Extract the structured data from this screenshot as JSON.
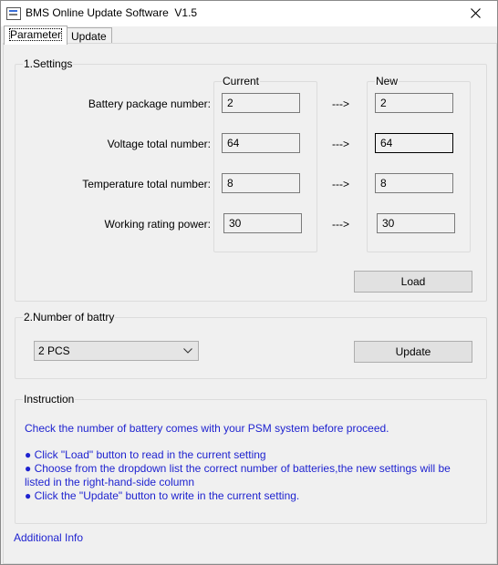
{
  "window": {
    "title": "BMS Online Update Software  V1.5"
  },
  "tabs": [
    {
      "label": "Parameter",
      "active": true
    },
    {
      "label": "Update",
      "active": false
    }
  ],
  "settings": {
    "group_title": "1.Settings",
    "current_header": "Current",
    "new_header": "New",
    "arrow": "--->",
    "rows": [
      {
        "label": "Battery package number:",
        "current": "2",
        "new": "2"
      },
      {
        "label": "Voltage total number:",
        "current": "64",
        "new": "64"
      },
      {
        "label": "Temperature total number:",
        "current": "8",
        "new": "8"
      },
      {
        "label": "Working rating power:",
        "current": "30",
        "new": "30"
      }
    ],
    "load_label": "Load"
  },
  "battery": {
    "group_title": "2.Number of battry",
    "selected": "2 PCS",
    "update_label": "Update"
  },
  "instruction": {
    "group_title": "Instruction",
    "intro": "Check the number of battery comes with your PSM system before proceed.",
    "bullets": [
      "●  Click \"Load\"  button  to read in the current setting",
      "●  Choose from the dropdown list the correct number of batteries,the new        settings will be",
      "listed in the right-hand-side column",
      "●  Click the \"Update\" button to write in the current setting."
    ]
  },
  "additional_info": "Additional Info",
  "colors": {
    "link_text": "#1f23d0",
    "window_bg": "#f0f0f0"
  }
}
